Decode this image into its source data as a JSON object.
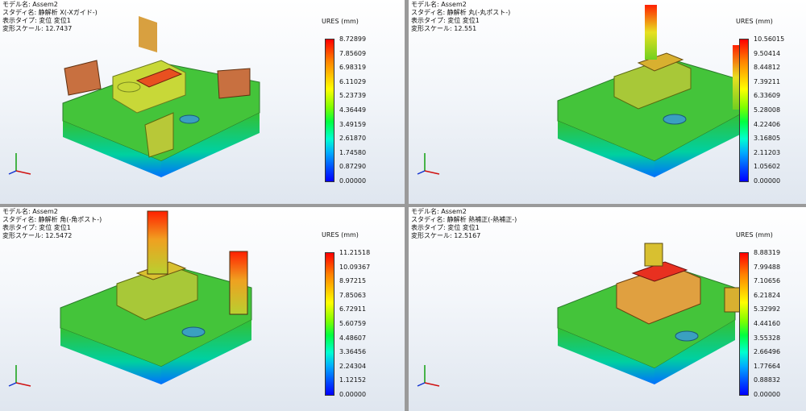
{
  "viewports": [
    {
      "info": [
        "モデル名: Assem2",
        "スタディ名: 静解析 X(-Xガイド-)",
        "表示タイプ: 変位 変位1",
        "変形スケール: 12.7437"
      ],
      "legend_title": "URES (mm)",
      "legend_values": [
        "8.72899",
        "7.85609",
        "6.98319",
        "6.11029",
        "5.23739",
        "4.36449",
        "3.49159",
        "2.61870",
        "1.74580",
        "0.87290",
        "0.00000"
      ]
    },
    {
      "info": [
        "モデル名: Assem2",
        "スタディ名: 静解析 丸(-丸ポスト-)",
        "表示タイプ: 変位 変位1",
        "変形スケール: 12.551"
      ],
      "legend_title": "URES (mm)",
      "legend_values": [
        "10.56015",
        "9.50414",
        "8.44812",
        "7.39211",
        "6.33609",
        "5.28008",
        "4.22406",
        "3.16805",
        "2.11203",
        "1.05602",
        "0.00000"
      ]
    },
    {
      "info": [
        "モデル名: Assem2",
        "スタディ名: 静解析 角(-角ポスト-)",
        "表示タイプ: 変位 変位1",
        "変形スケール: 12.5472"
      ],
      "legend_title": "URES (mm)",
      "legend_values": [
        "11.21518",
        "10.09367",
        "8.97215",
        "7.85063",
        "6.72911",
        "5.60759",
        "4.48607",
        "3.36456",
        "2.24304",
        "1.12152",
        "0.00000"
      ]
    },
    {
      "info": [
        "モデル名: Assem2",
        "スタディ名: 静解析 熱補正(-熱補正-)",
        "表示タイプ: 変位 変位1",
        "変形スケール: 12.5167"
      ],
      "legend_title": "URES (mm)",
      "legend_values": [
        "8.88319",
        "7.99488",
        "7.10656",
        "6.21824",
        "5.32992",
        "4.44160",
        "3.55328",
        "2.66496",
        "1.77664",
        "0.88832",
        "0.00000"
      ]
    }
  ],
  "colors": {
    "max": "#ff0000",
    "mid": "#7dff00",
    "min": "#0000ff",
    "plate": "#3fc43a"
  }
}
